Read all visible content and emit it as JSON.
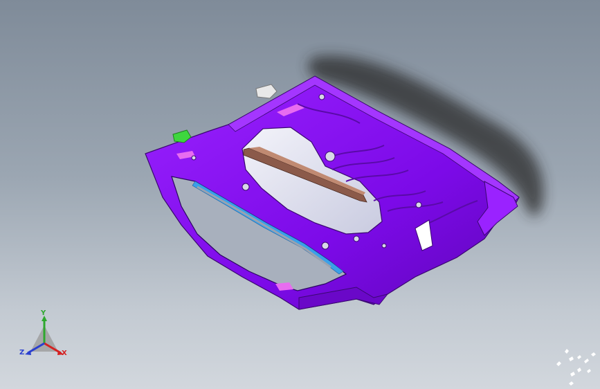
{
  "viewport": {
    "background_top": "#7f8b99",
    "background_bottom": "#d2d7dd"
  },
  "model": {
    "body_color": "#8a10f0",
    "highlight_color": "#b03cff",
    "accent_pink": "#e86cf0",
    "glass_color": "#e2e3ee",
    "rail_color": "#8b5a4a",
    "seal_color": "#3aa0e8",
    "clip_green": "#3ed63e",
    "clip_white": "#e8e8e8",
    "shadow_color": "#2a2a2a"
  },
  "triad": {
    "x_label": "X",
    "y_label": "Y",
    "z_label": "Z",
    "x_color": "#d42222",
    "y_color": "#2ea82e",
    "z_color": "#2a3fcf"
  },
  "watermark": {
    "icon": "bird-flock-icon"
  }
}
